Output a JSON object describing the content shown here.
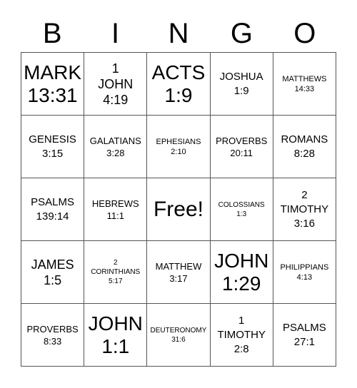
{
  "header": {
    "letters": [
      "B",
      "I",
      "N",
      "G",
      "O"
    ]
  },
  "board": {
    "cells": [
      {
        "text": "MARK\n13:31",
        "size": "s-xl"
      },
      {
        "text": "1\nJOHN\n4:19",
        "size": "s-l"
      },
      {
        "text": "ACTS\n1:9",
        "size": "s-xl"
      },
      {
        "text": "JOSHUA\n1:9",
        "size": "s-m"
      },
      {
        "text": "MATTHEWS\n14:33",
        "size": "s-xs"
      },
      {
        "text": "GENESIS\n3:15",
        "size": "s-m"
      },
      {
        "text": "GALATIANS\n3:28",
        "size": "s-s"
      },
      {
        "text": "EPHESIANS\n2:10",
        "size": "s-xs"
      },
      {
        "text": "PROVERBS\n20:11",
        "size": "s-s"
      },
      {
        "text": "ROMANS\n8:28",
        "size": "s-m"
      },
      {
        "text": "PSALMS\n139:14",
        "size": "s-m"
      },
      {
        "text": "HEBREWS\n11:1",
        "size": "s-s"
      },
      {
        "text": "Free!",
        "size": "s-free"
      },
      {
        "text": "COLOSSIANS\n1:3",
        "size": "s-xxs"
      },
      {
        "text": "2\nTIMOTHY\n3:16",
        "size": "s-m"
      },
      {
        "text": "JAMES\n1:5",
        "size": "s-l"
      },
      {
        "text": "2\nCORINTHIANS\n5:17",
        "size": "s-xxs"
      },
      {
        "text": "MATTHEW\n3:17",
        "size": "s-s"
      },
      {
        "text": "JOHN\n1:29",
        "size": "s-xl"
      },
      {
        "text": "PHILIPPIANS\n4:13",
        "size": "s-xs"
      },
      {
        "text": "PROVERBS\n8:33",
        "size": "s-s"
      },
      {
        "text": "JOHN\n1:1",
        "size": "s-xl"
      },
      {
        "text": "DEUTERONOMY\n31:6",
        "size": "s-xxs"
      },
      {
        "text": "1\nTIMOTHY\n2:8",
        "size": "s-m"
      },
      {
        "text": "PSALMS\n27:1",
        "size": "s-m"
      }
    ]
  }
}
